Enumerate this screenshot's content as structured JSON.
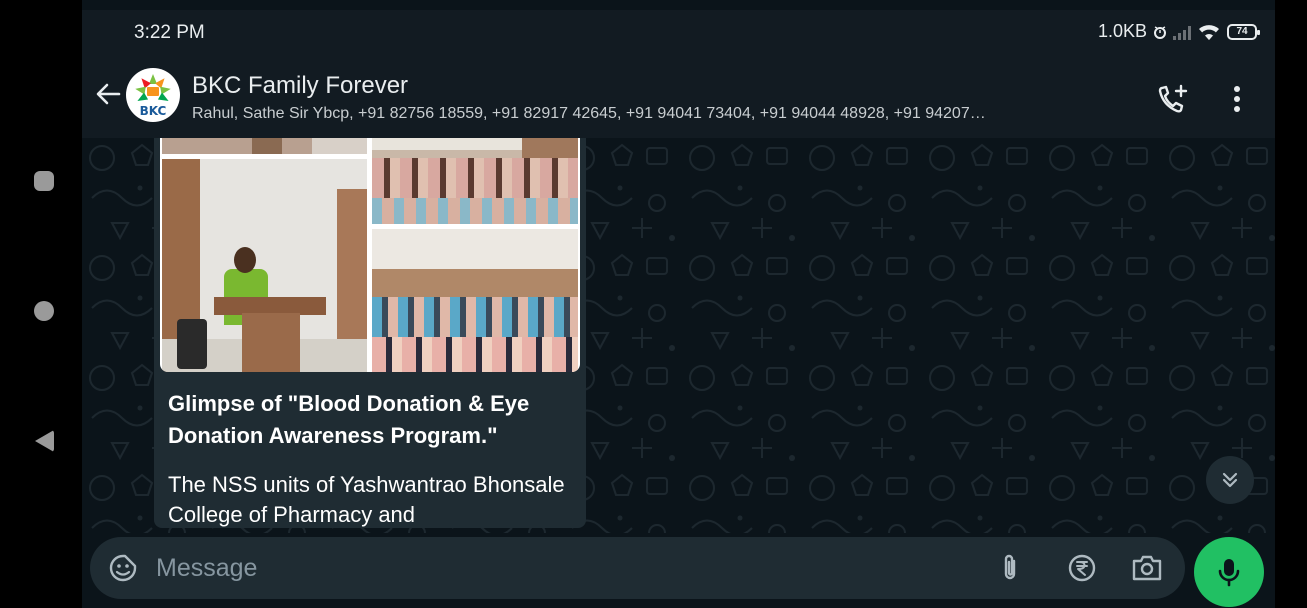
{
  "status_bar": {
    "time": "3:22 PM",
    "data_speed": "1.0KB",
    "battery_level": "74"
  },
  "header": {
    "group_name": "BKC Family Forever",
    "members": "Rahul, Sathe Sir Ybcp, +91 82756 18559, +91 82917 42645, +91 94041 73404, +91 94044 48928, +91 94207…",
    "avatar_text": "BKC"
  },
  "message": {
    "title": "Glimpse of \"Blood Donation & Eye Donation Awareness Program.\"",
    "body": "The NSS units of Yashwantrao Bhonsale College of Pharmacy and"
  },
  "input": {
    "placeholder": "Message"
  },
  "colors": {
    "header_bg": "#121b22",
    "chat_bg": "#0b141a",
    "bubble_bg": "#1f2c33",
    "accent_green": "#21c063"
  },
  "icons": {
    "back": "back-arrow-icon",
    "add_call": "add-call-icon",
    "menu": "more-vert-icon",
    "scroll_down": "double-chevron-down-icon",
    "sticker": "sticker-icon",
    "attach": "paperclip-icon",
    "payment": "rupee-icon",
    "camera": "camera-icon",
    "mic": "mic-icon"
  }
}
